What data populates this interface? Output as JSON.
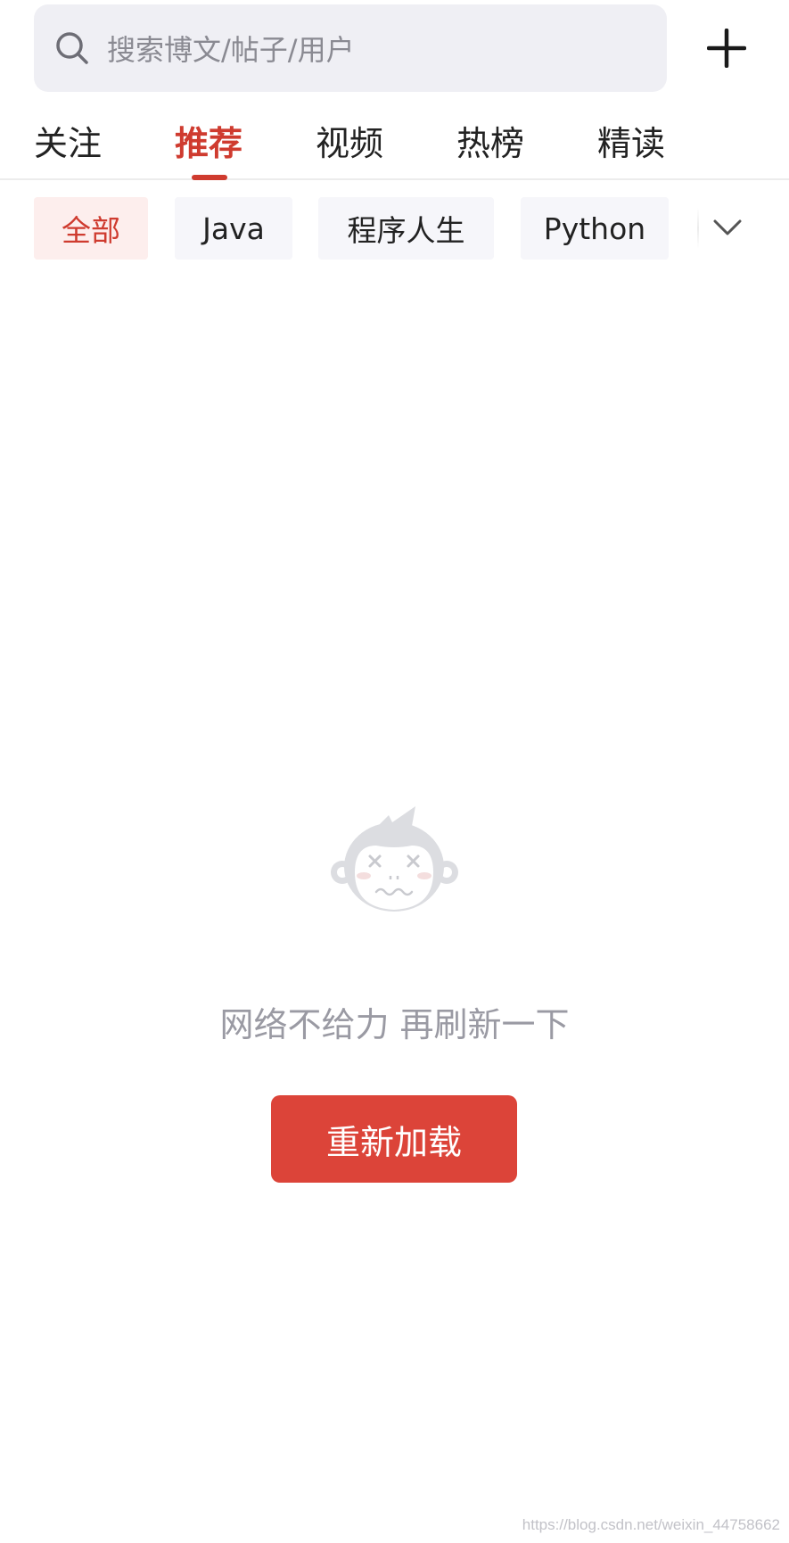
{
  "search": {
    "placeholder": "搜索博文/帖子/用户",
    "icon": "search-icon",
    "add_icon": "plus-icon"
  },
  "tabs": [
    {
      "label": "关注",
      "active": false
    },
    {
      "label": "推荐",
      "active": true
    },
    {
      "label": "视频",
      "active": false
    },
    {
      "label": "热榜",
      "active": false
    },
    {
      "label": "精读",
      "active": false
    }
  ],
  "chips": [
    {
      "label": "全部",
      "active": true
    },
    {
      "label": "Java",
      "active": false
    },
    {
      "label": "程序人生",
      "active": false
    },
    {
      "label": "Python",
      "active": false
    }
  ],
  "chips_more_icon": "chevron-down-icon",
  "empty_state": {
    "illustration": "dizzy-monkey-icon",
    "message": "网络不给力 再刷新一下",
    "button_label": "重新加载"
  },
  "watermark": "https://blog.csdn.net/weixin_44758662",
  "colors": {
    "accent": "#cf3b2f",
    "button": "#dc4439",
    "chip_active_bg": "#fdeeed",
    "chip_bg": "#f6f6fa",
    "search_bg": "#efeff4",
    "muted_text": "#9a9aa3"
  }
}
